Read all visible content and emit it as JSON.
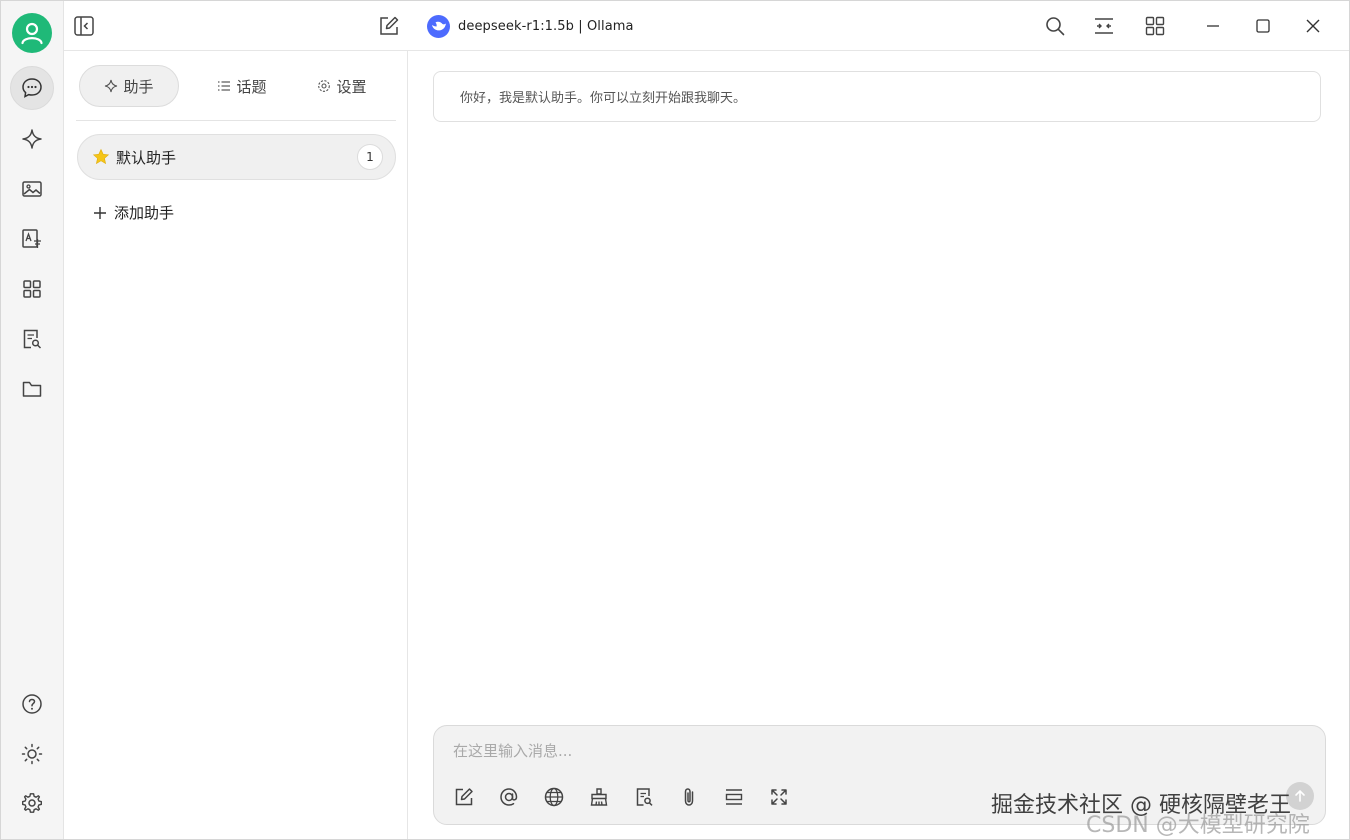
{
  "titlebar": {
    "model_title": "deepseek-r1:1.5b | Ollama"
  },
  "panel": {
    "tabs": [
      {
        "label": "助手",
        "icon": "sparkle-icon"
      },
      {
        "label": "话题",
        "icon": "list-icon"
      },
      {
        "label": "设置",
        "icon": "gear-icon"
      }
    ],
    "assistant": {
      "name": "默认助手",
      "count": "1",
      "icon": "star-icon"
    },
    "add_label": "添加助手"
  },
  "main": {
    "greeting": "你好，我是默认助手。你可以立刻开始跟我聊天。",
    "composer_placeholder": "在这里输入消息..."
  },
  "watermark": {
    "line1": "掘金技术社区 @ 硬核隔壁老王",
    "line2": "CSDN @大模型研究院"
  },
  "colors": {
    "avatar": "#1fb978",
    "model_logo": "#4d6bfe",
    "star": "#f5c518"
  }
}
